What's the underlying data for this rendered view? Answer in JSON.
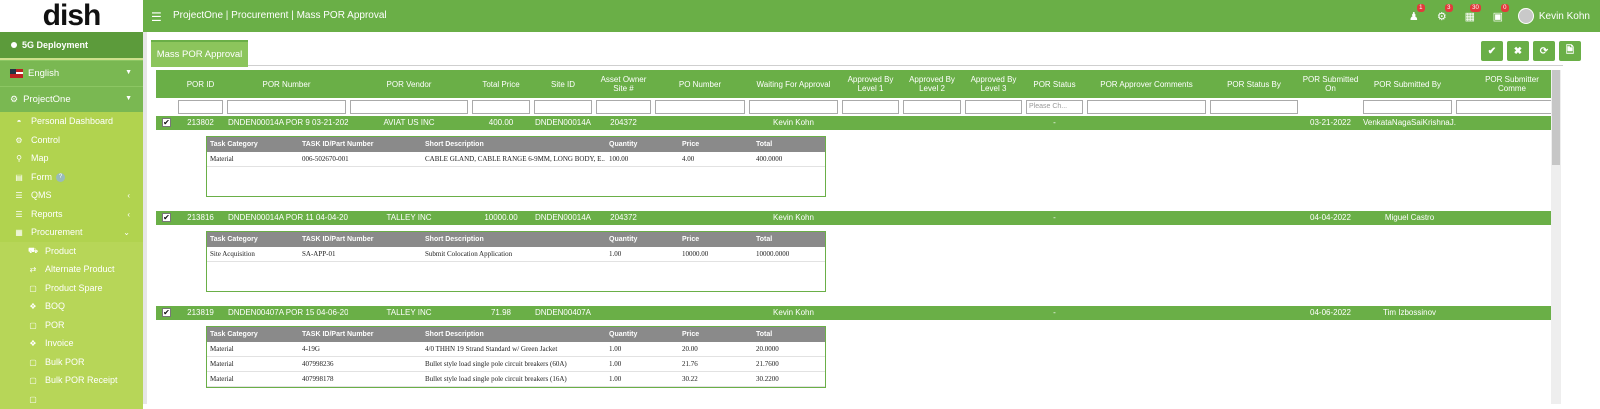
{
  "app": {
    "logo": "dish",
    "breadcrumb": "ProjectOne | Procurement | Mass POR Approval",
    "user_name": "Kevin Kohn"
  },
  "notifications": [
    {
      "icon": "user-alert-icon",
      "count": "1"
    },
    {
      "icon": "gear-alert-icon",
      "count": "3"
    },
    {
      "icon": "calendar-icon",
      "count": "30"
    },
    {
      "icon": "task-icon",
      "count": "0"
    }
  ],
  "sidebar": {
    "deployment": "5G Deployment",
    "language": "English",
    "project": "ProjectOne",
    "items": [
      {
        "label": "Personal Dashboard",
        "icon": "dashboard-icon"
      },
      {
        "label": "Control",
        "icon": "gear-icon"
      },
      {
        "label": "Map",
        "icon": "map-pin-icon"
      },
      {
        "label": "Form",
        "icon": "form-icon",
        "help": "?"
      },
      {
        "label": "QMS",
        "icon": "list-icon"
      },
      {
        "label": "Reports",
        "icon": "list-icon"
      },
      {
        "label": "Procurement",
        "icon": "grid-icon"
      }
    ],
    "sub_items": [
      {
        "label": "Product",
        "icon": "truck-icon"
      },
      {
        "label": "Alternate Product",
        "icon": "swap-icon"
      },
      {
        "label": "Product Spare",
        "icon": "document-icon"
      },
      {
        "label": "BOQ",
        "icon": "cubes-icon"
      },
      {
        "label": "POR",
        "icon": "document-icon"
      },
      {
        "label": "Invoice",
        "icon": "cubes-icon"
      },
      {
        "label": "Bulk POR",
        "icon": "document-icon"
      },
      {
        "label": "Bulk POR Receipt",
        "icon": "document-icon"
      }
    ]
  },
  "page": {
    "tab": "Mass POR Approval",
    "actions": [
      {
        "name": "approve-button",
        "icon": "✔"
      },
      {
        "name": "reject-button",
        "icon": "✖"
      },
      {
        "name": "refresh-button",
        "icon": "⟳"
      },
      {
        "name": "export-button",
        "icon": "🗎"
      }
    ]
  },
  "grid": {
    "columns": [
      "POR ID",
      "POR Number",
      "POR Vendor",
      "Total Price",
      "Site ID",
      "Asset Owner Site #",
      "PO Number",
      "Waiting For Approval",
      "Approved By Level 1",
      "Approved By Level 2",
      "Approved By Level 3",
      "POR Status",
      "POR Approver Comments",
      "POR Status By",
      "POR Submitted On",
      "POR Submitted By",
      "POR Submitter Comme"
    ],
    "status_filter_placeholder": "Please Ch...",
    "detail_columns": [
      "Task Category",
      "TASK ID/Part Number",
      "Short Description",
      "Quantity",
      "Price",
      "Total"
    ],
    "rows": [
      {
        "checked": "✔",
        "por_id": "213802",
        "por_number": "DNDEN00014A POR 9 03-21-2022",
        "vendor": "AVIAT US INC",
        "total_price": "400.00",
        "site_id": "DNDEN00014A",
        "asset_owner_site": "204372",
        "waiting_for": "Kevin Kohn",
        "status": "-",
        "submitted_on": "03-21-2022",
        "submitted_by": "VenkataNagaSaiKrishnaJ...",
        "details": [
          {
            "category": "Material",
            "part": "006-502670-001",
            "desc": "CABLE GLAND, CABLE RANGE 6-9MM, LONG BODY, E...",
            "qty": "100.00",
            "price": "4.00",
            "total": "400.0000"
          }
        ]
      },
      {
        "checked": "✔",
        "por_id": "213816",
        "por_number": "DNDEN00014A POR 11 04-04-2022",
        "vendor": "TALLEY INC",
        "total_price": "10000.00",
        "site_id": "DNDEN00014A",
        "asset_owner_site": "204372",
        "waiting_for": "Kevin Kohn",
        "status": "-",
        "submitted_on": "04-04-2022",
        "submitted_by": "Miguel Castro",
        "details": [
          {
            "category": "Site Acquisition",
            "part": "SA-APP-01",
            "desc": "Submit Colocation Application",
            "qty": "1.00",
            "price": "10000.00",
            "total": "10000.0000"
          }
        ]
      },
      {
        "checked": "✔",
        "por_id": "213819",
        "por_number": "DNDEN00407A POR 15 04-06-2022",
        "vendor": "TALLEY INC",
        "total_price": "71.98",
        "site_id": "DNDEN00407A",
        "asset_owner_site": "",
        "waiting_for": "Kevin Kohn",
        "status": "-",
        "submitted_on": "04-06-2022",
        "submitted_by": "Tim Izbossinov",
        "details": [
          {
            "category": "Material",
            "part": "4-19G",
            "desc": "4/0 THHN 19 Strand Standard w/ Green Jacket",
            "qty": "1.00",
            "price": "20.00",
            "total": "20.0000"
          },
          {
            "category": "Material",
            "part": "407998236",
            "desc": "Bullet style load single pole circuit breakers (60A)",
            "qty": "1.00",
            "price": "21.76",
            "total": "21.7600"
          },
          {
            "category": "Material",
            "part": "407998178",
            "desc": "Bullet style load single pole circuit breakers (16A)",
            "qty": "1.00",
            "price": "30.22",
            "total": "30.2200"
          }
        ]
      }
    ]
  }
}
